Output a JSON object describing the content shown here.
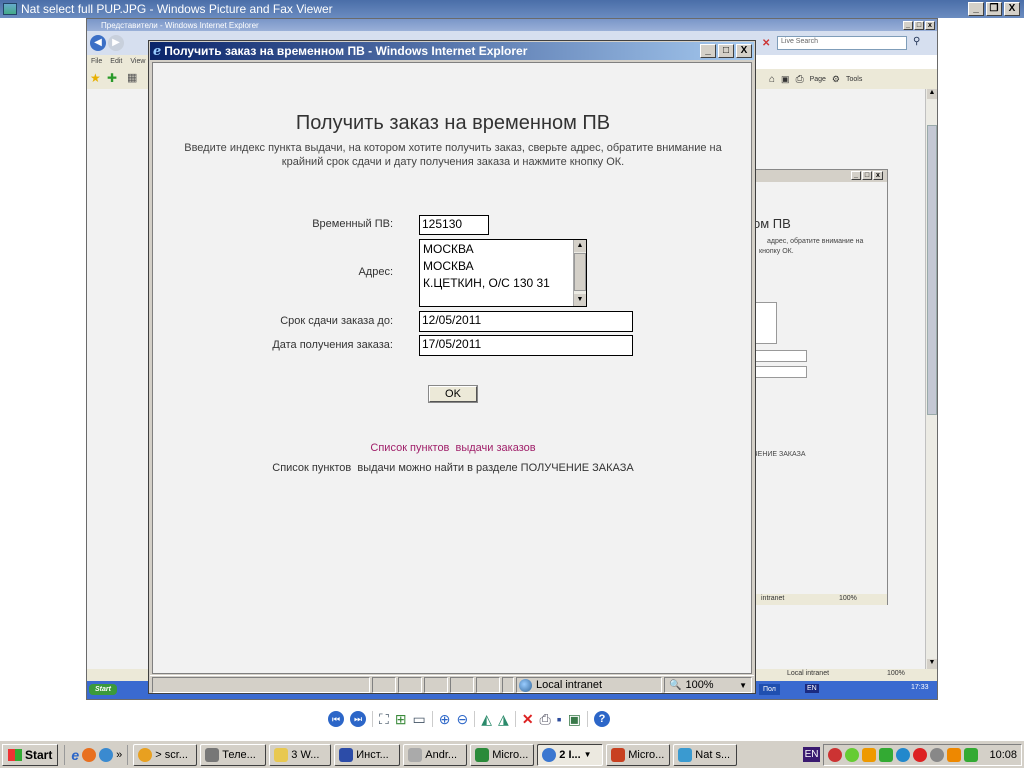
{
  "viewer": {
    "title": "Nat select full PUP.JPG - Windows Picture and Fax Viewer",
    "controls": {
      "min": "_",
      "restore": "❐",
      "close": "X"
    }
  },
  "ie_back": {
    "title": "Представители - Windows Internet Explorer",
    "menu": [
      "File",
      "Edit",
      "View"
    ],
    "search_placeholder": "Live Search",
    "toolbar": {
      "page": "Page",
      "tools": "Tools"
    },
    "status": {
      "zone": "Local intranet",
      "zoom": "100%"
    },
    "taskbar": {
      "start": "Start",
      "item": "Пол",
      "lang": "EN",
      "clock": "17:33"
    }
  },
  "ie_mid": {
    "heading_fragment": "ом ПВ",
    "text_fragment_1": "адрес, обратите внимание на",
    "text_fragment_2": "кнопку ОК.",
    "section_fragment": "ЧЕНИЕ ЗАКАЗА",
    "status_zone": "intranet",
    "zoom": "100%"
  },
  "popup": {
    "title": "Получить заказ на временном ПВ - Windows Internet Explorer",
    "heading": "Получить заказ на временном ПВ",
    "intro_line1": "Введите индекс пункта выдачи, на котором хотите получить заказ, сверьте адрес, обратите внимание на",
    "intro_line2": "крайний срок сдачи и дату получения заказа и нажмите кнопку ОК.",
    "form": {
      "pv_label": "Временный ПВ:",
      "pv_value": "125130",
      "address_label": "Адрес:",
      "address_lines": [
        "МОСКВА",
        "МОСКВА",
        "К.ЦЕТКИН, О/С 130 31"
      ],
      "deadline_label": "Срок сдачи заказа до:",
      "deadline_value": "12/05/2011",
      "receive_label": "Дата получения заказа:",
      "receive_value": "17/05/2011",
      "ok_button": "OK"
    },
    "link": "Список пунктов  выдачи заказов",
    "note": "Список пунктов  выдачи можно найти в разделе ПОЛУЧЕНИЕ ЗАКАЗА",
    "status": {
      "zone": "Local intranet",
      "zoom": "100%"
    }
  },
  "taskbar": {
    "start": "Start",
    "items": [
      "> scr...",
      "Теле...",
      "3 W...",
      "Инст...",
      "Andr...",
      "Micro...",
      "2 I...",
      "Micro...",
      "Nat s..."
    ],
    "lang": "EN",
    "clock": "10:08"
  }
}
